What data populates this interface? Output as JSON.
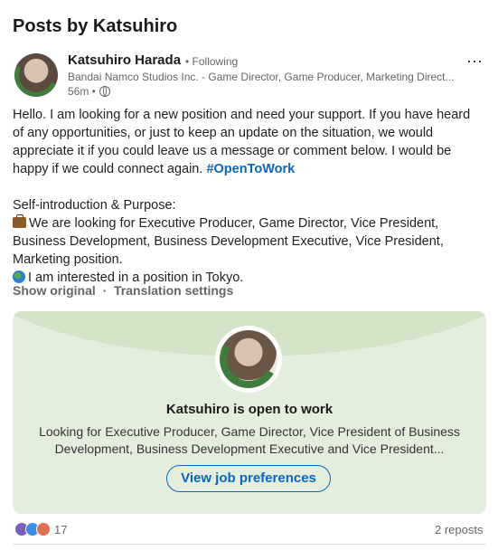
{
  "section_title": "Posts by Katsuhiro",
  "post": {
    "author_name": "Katsuhiro Harada",
    "follow_status": "• Following",
    "headline": "Bandai Namco Studios Inc. - Game Director, Game Producer, Marketing Direct...",
    "time": "56m •",
    "more_icon": "⋯",
    "body": {
      "p1": "Hello. I am looking for a new position and need your support. If you have heard of any opportunities, or just to keep an update on the situation, we would appreciate it if you could leave us a message or comment below. I would be happy if we could connect again.",
      "hashtag": "#OpenToWork",
      "p2_heading": "Self-introduction & Purpose:",
      "p2_line1": "We are looking for Executive Producer, Game Director, Vice President, Business Development, Business Development Executive, Vice President, Marketing position.",
      "p2_line2": "I am interested in a position in Tokyo."
    },
    "show_original": "Show original",
    "separator": "·",
    "translation_settings": "Translation settings",
    "open_to_work": {
      "title": "Katsuhiro is open to work",
      "description": "Looking for Executive Producer, Game Director, Vice President of Business Development, Business Development Executive and Vice President...",
      "button": "View job preferences",
      "badge_text": "#OPENTOWORK"
    },
    "reactions_count": "17",
    "reposts": "2 reposts"
  },
  "colors": {
    "link": "#0a66c2",
    "otw_bg": "#e3eedd",
    "otw_ring": "#3f7d3c"
  }
}
